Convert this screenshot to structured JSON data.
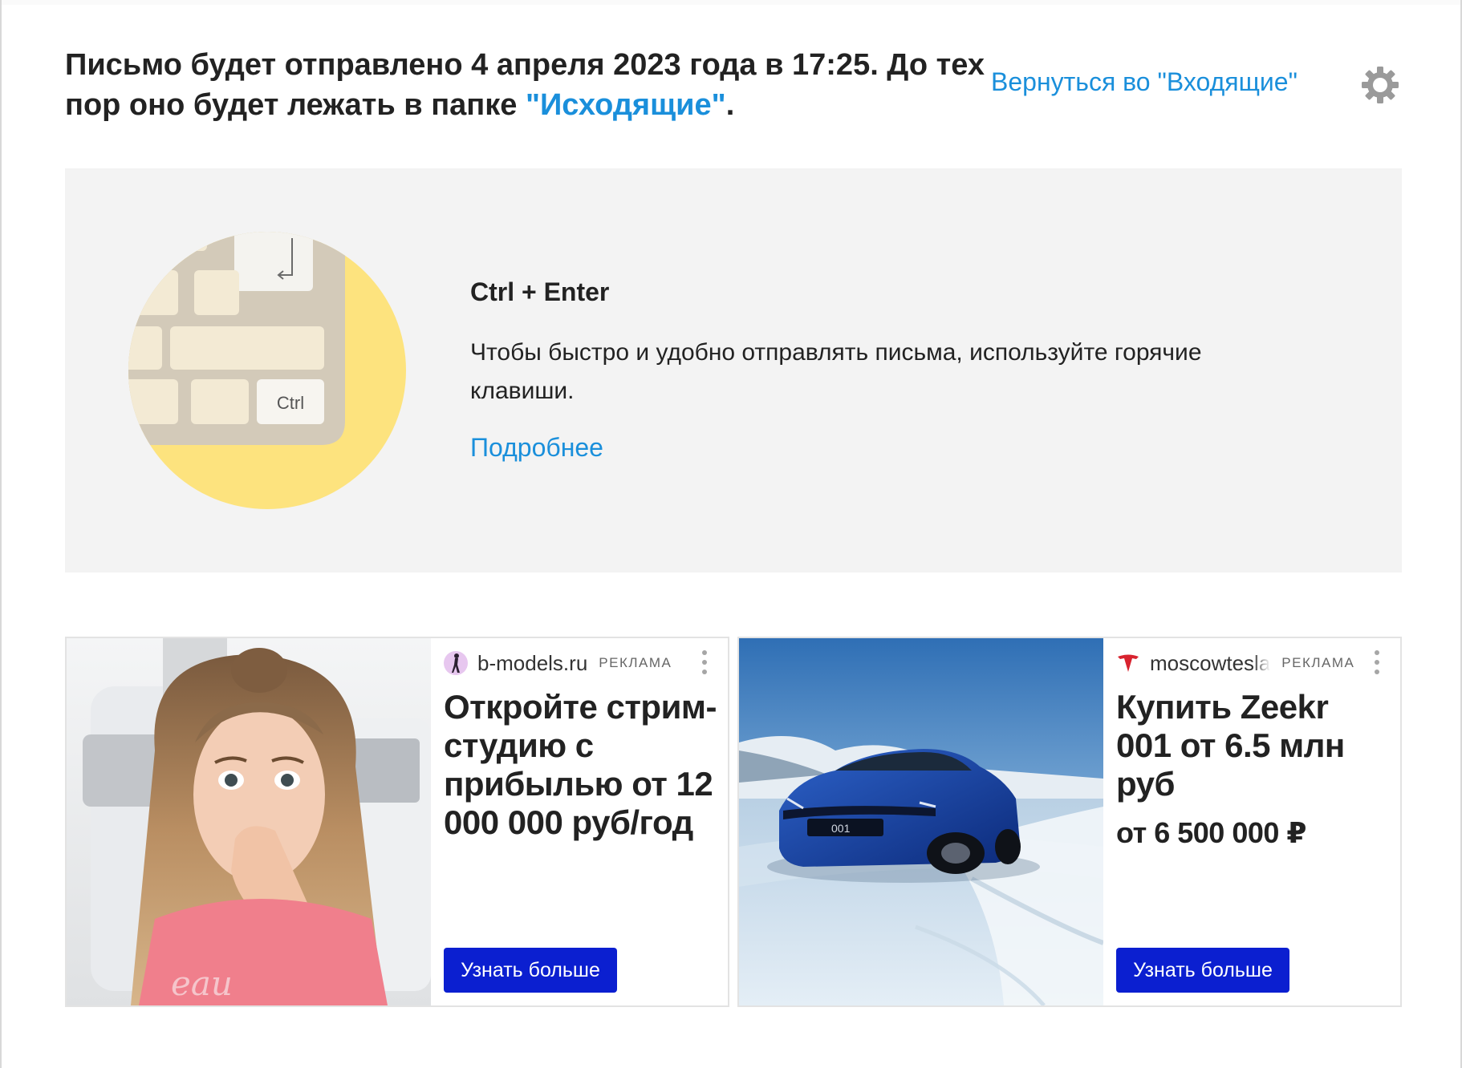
{
  "status": {
    "message_prefix": "Письмо будет отправлено 4 апреля 2023 года в 17:25. До тех пор оно будет лежать в папке ",
    "folder_link": "\"Исходящие\"",
    "message_suffix": "."
  },
  "header": {
    "back_link": "Вернуться во \"Входящие\""
  },
  "tip": {
    "key_label": "Ctrl",
    "title": "Ctrl + Enter",
    "text": "Чтобы быстро и удобно отправлять письма, используйте горячие клавиши.",
    "more_link": "Подробнее"
  },
  "ads": [
    {
      "domain": "b-models.ru",
      "label": "РЕКЛАМА",
      "headline": "Откройте стрим-студию с прибылью от 12 000 000 руб/год",
      "price": "",
      "cta": "Узнать больше"
    },
    {
      "domain": "moscowtesla",
      "label": "РЕКЛАМА",
      "headline": "Купить Zeekr 001 от 6.5 млн руб",
      "price": "от 6 500 000 ₽",
      "cta": "Узнать больше",
      "plate": "001"
    }
  ],
  "colors": {
    "link": "#1a8fdb",
    "cta": "#0b1fd0",
    "panel": "#f3f3f3",
    "illustration_yellow": "#fde37e"
  }
}
